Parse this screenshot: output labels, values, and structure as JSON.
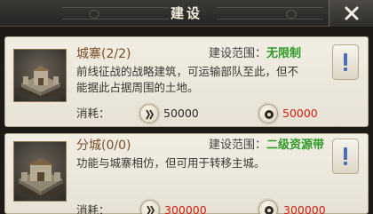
{
  "title_bar": {
    "title": "建设",
    "close_icon": "close-x-icon"
  },
  "buildings": [
    {
      "name": "城寨",
      "count": "(2/2)",
      "range_label": "建设范围：",
      "range_value": "无限制",
      "desc_line1": "前线征战的战略建筑，可运输部队至此，但不",
      "desc_line2": "能据此占据周围的土地。",
      "cost_label": "消耗：",
      "cost_a": "50000",
      "cost_b": "50000",
      "thumb_icon": "fortress-icon",
      "info_icon": "exclamation-icon"
    },
    {
      "name": "分城",
      "count": "(0/0)",
      "range_label": "建设范围：",
      "range_value": "二级资源带",
      "desc_line1": "功能与城寨相仿，但可用于转移主城。",
      "cost_label": "消耗：",
      "cost_a": "300000",
      "cost_b": "300000",
      "thumb_icon": "city-icon",
      "info_icon": "exclamation-icon"
    }
  ],
  "colors": {
    "range_value": "#2f9a28",
    "cost_insufficient": "#d21d10",
    "name": "#7a4e28"
  }
}
